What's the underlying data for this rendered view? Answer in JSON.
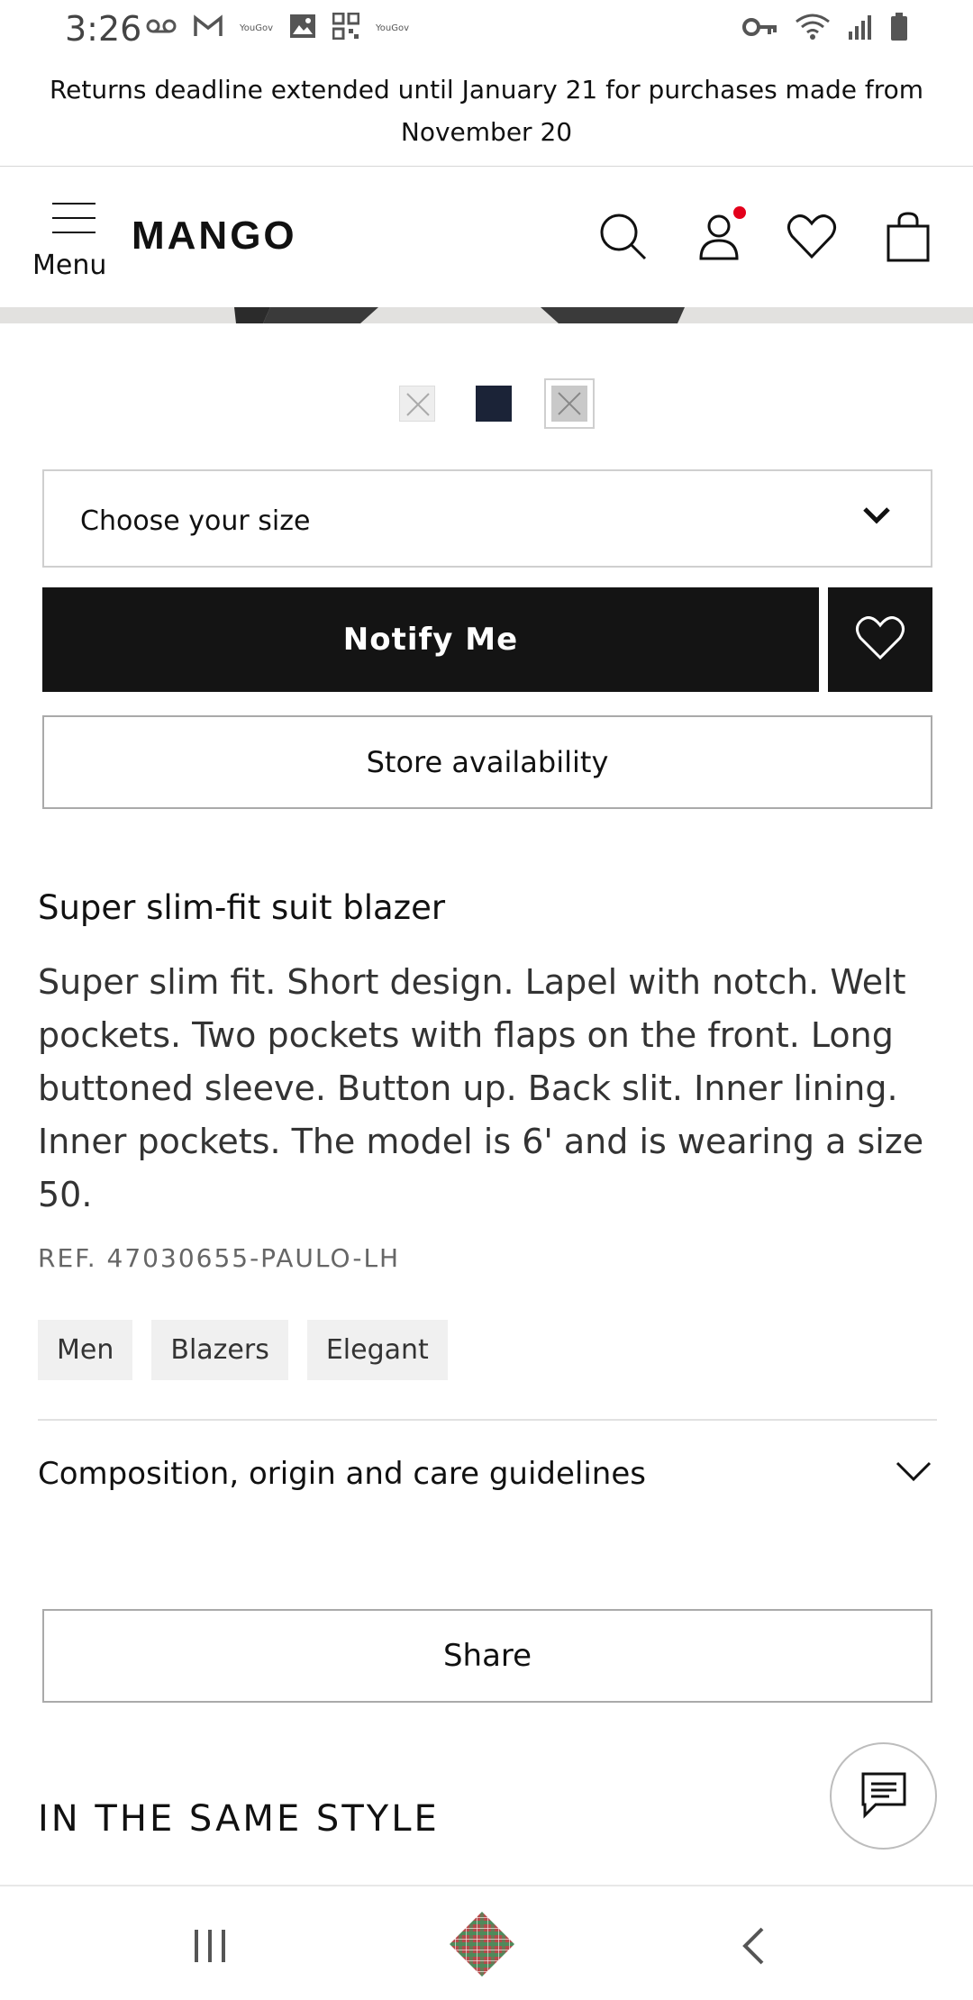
{
  "status_bar": {
    "time": "3:26",
    "left_icons": [
      "voicemail-icon",
      "gmail-icon",
      "yougov-icon",
      "gallery-icon",
      "qr-code-icon",
      "yougov-icon"
    ],
    "left_small_text_1": "YouGov",
    "left_small_text_2": "YouGov",
    "right_icons": [
      "key-icon",
      "wifi-icon",
      "signal-icon",
      "battery-icon"
    ]
  },
  "announcement": {
    "text": "Returns deadline extended until January 21 for purchases made from November 20"
  },
  "header": {
    "menu_label": "Menu",
    "logo": "MANGO",
    "icons": [
      "search-icon",
      "account-icon",
      "wishlist-icon",
      "bag-icon"
    ],
    "account_badge_color": "#e3001b"
  },
  "swatches": [
    {
      "name": "unavailable-light",
      "color": "#eeeeee",
      "unavailable": true
    },
    {
      "name": "navy",
      "color": "#1b2337",
      "unavailable": false
    },
    {
      "name": "unavailable-grey",
      "color": "#c9c9c9",
      "unavailable": true,
      "selected": true
    }
  ],
  "size_select": {
    "label": "Choose your size"
  },
  "actions": {
    "notify_label": "Notify Me",
    "store_label": "Store availability",
    "share_label": "Share"
  },
  "product": {
    "title": "Super slim-fit suit blazer",
    "description": "Super slim fit. Short design. Lapel with notch. Welt pockets. Two pockets with flaps on the front. Long buttoned sleeve. Button up. Back slit. Inner lining. Inner pockets. The model is 6' and is wearing a size 50.",
    "ref": "REF. 47030655-PAULO-LH",
    "tags": [
      "Men",
      "Blazers",
      "Elegant"
    ]
  },
  "accordion": {
    "label": "Composition, origin and care guidelines"
  },
  "section": {
    "same_style": "IN THE SAME STYLE"
  },
  "colors": {
    "primary": "#141414",
    "accent_red": "#e3001b",
    "border": "#cfcfcf"
  }
}
